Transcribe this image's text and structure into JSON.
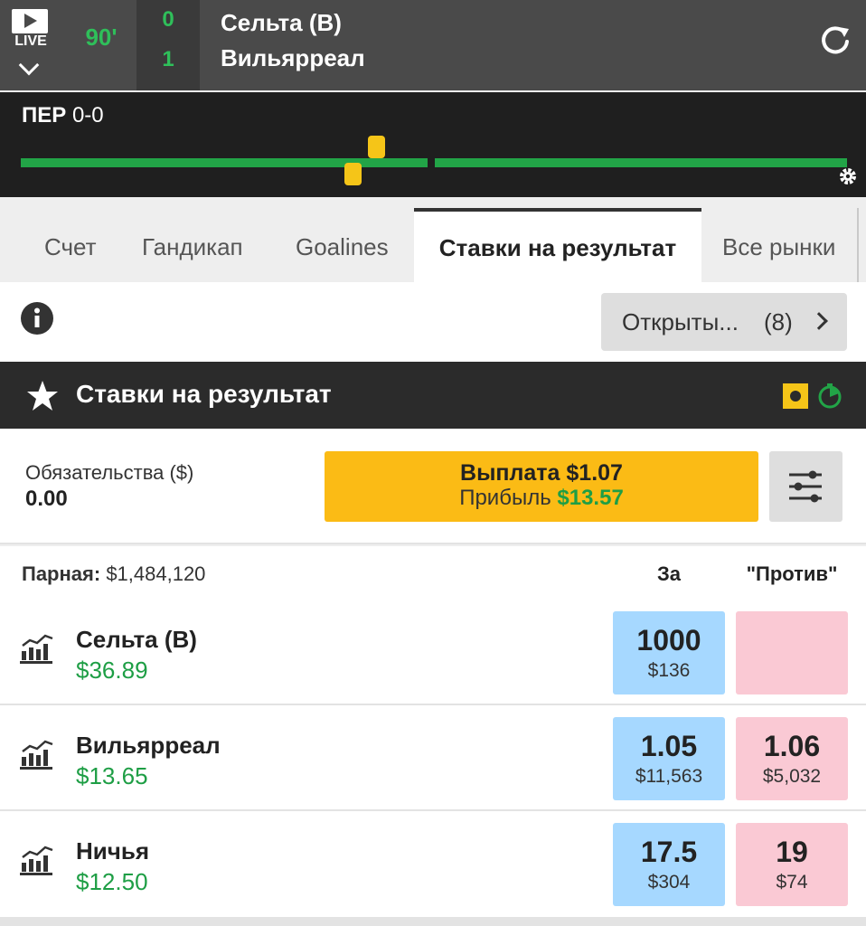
{
  "header": {
    "live_label": "LIVE",
    "minute": "90'",
    "score_home": "0",
    "score_away": "1",
    "team_home": "Сельта (В)",
    "team_away": "Вильярреал"
  },
  "timeline": {
    "period_label": "ПЕР",
    "period_score": "0-0"
  },
  "tabs": [
    {
      "label": "Счет"
    },
    {
      "label": "Гандикап"
    },
    {
      "label": "Goalines"
    },
    {
      "label": "Ставки на результат",
      "active": true
    },
    {
      "label": "Все рынки"
    }
  ],
  "info_row": {
    "open_label": "Открыты...",
    "open_count": "(8)"
  },
  "market": {
    "title": "Ставки на результат"
  },
  "liability": {
    "label": "Обязательства ($)",
    "value": "0.00"
  },
  "payout": {
    "payout_label": "Выплата $1.07",
    "profit_label": "Прибыль",
    "profit_value": "$13.57"
  },
  "runners_header": {
    "matched_label": "Парная:",
    "matched_value": "$1,484,120",
    "back_label": "За",
    "lay_label": "\"Против\""
  },
  "runners": [
    {
      "name": "Сельта (В)",
      "pnl": "$36.89",
      "back_price": "1000",
      "back_size": "$136",
      "lay_price": "",
      "lay_size": ""
    },
    {
      "name": "Вильярреал",
      "pnl": "$13.65",
      "back_price": "1.05",
      "back_size": "$11,563",
      "lay_price": "1.06",
      "lay_size": "$5,032"
    },
    {
      "name": "Ничья",
      "pnl": "$12.50",
      "back_price": "17.5",
      "back_size": "$304",
      "lay_price": "19",
      "lay_size": "$74"
    }
  ],
  "colors": {
    "accent_green": "#22a447",
    "payout_yellow": "#fbbb15",
    "back_blue": "#a6d8ff",
    "lay_pink": "#fac9d4"
  }
}
